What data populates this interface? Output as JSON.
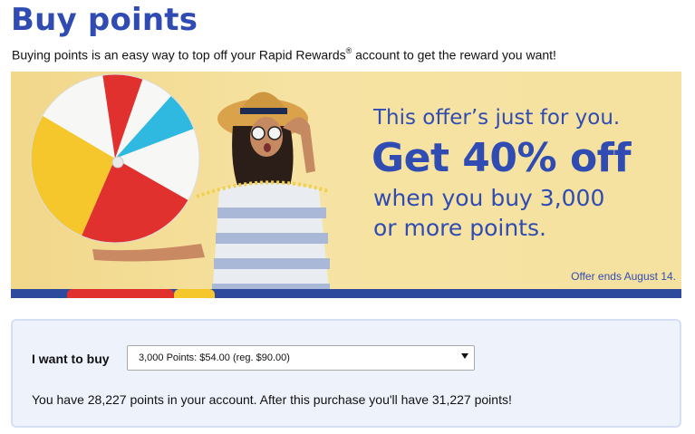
{
  "page": {
    "title": "Buy points",
    "subtitle_before": "Buying points is an easy way to top off your Rapid Rewards",
    "subtitle_reg": "®",
    "subtitle_after": " account to get the reward you want!"
  },
  "banner": {
    "line1": "This offer’s just for you.",
    "line2": "Get 40% off",
    "line3": "when you buy 3,000",
    "line4": "or more points.",
    "offer_ends": "Offer ends August 14.",
    "colors": {
      "blue": "#304cb2",
      "red": "#e0312f",
      "yellow": "#f5c72c",
      "background": "#f3dc8a"
    }
  },
  "purchase": {
    "label": "I want to buy",
    "selected_option": "3,000 Points: $54.00 (reg. $90.00)",
    "dropdown_icon": "chevron-down-icon",
    "points_message": "You have 28,227 points in your account. After this purchase you'll have 31,227 points!"
  }
}
